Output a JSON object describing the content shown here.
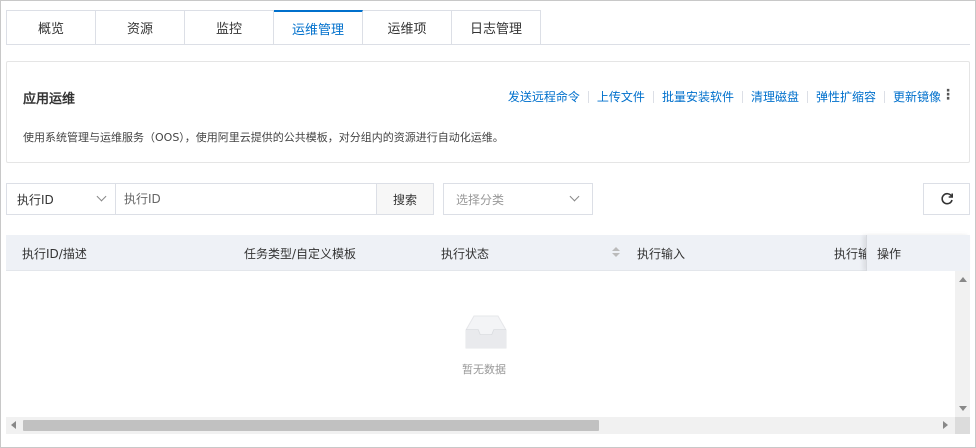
{
  "tabs": [
    {
      "label": "概览",
      "active": false
    },
    {
      "label": "资源",
      "active": false
    },
    {
      "label": "监控",
      "active": false
    },
    {
      "label": "运维管理",
      "active": true
    },
    {
      "label": "运维项",
      "active": false
    },
    {
      "label": "日志管理",
      "active": false
    }
  ],
  "panel": {
    "title": "应用运维",
    "description": "使用系统管理与运维服务（OOS），使用阿里云提供的公共模板，对分组内的资源进行自动化运维。",
    "actions": [
      "发送远程命令",
      "上传文件",
      "批量安装软件",
      "清理磁盘",
      "弹性扩缩容",
      "更新镜像"
    ],
    "more_icon": "more-vertical-icon"
  },
  "filter": {
    "field_select": "执行ID",
    "search_placeholder": "执行ID",
    "search_button": "搜索",
    "category_placeholder": "选择分类",
    "refresh_icon": "refresh-icon"
  },
  "table": {
    "columns": [
      "执行ID/描述",
      "任务类型/自定义模板",
      "执行状态",
      "执行输入",
      "执行输出",
      "操作"
    ],
    "empty_text": "暂无数据"
  },
  "colors": {
    "accent": "#0070cc",
    "header_bg": "#eef1f6",
    "border": "#dcdfe6"
  }
}
